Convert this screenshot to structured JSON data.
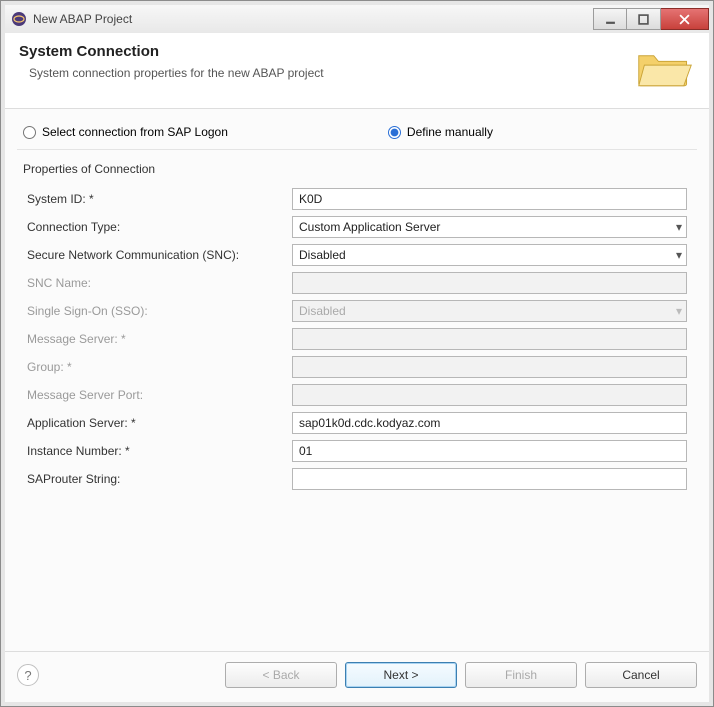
{
  "window": {
    "title": "New ABAP Project"
  },
  "header": {
    "title": "System Connection",
    "subtitle": "System connection properties for the new ABAP project"
  },
  "radios": {
    "sapLogon": "Select connection from SAP Logon",
    "manual": "Define manually"
  },
  "group": {
    "legend": "Properties of Connection"
  },
  "labels": {
    "systemId": "System ID: *",
    "connType": "Connection Type:",
    "snc": "Secure Network Communication (SNC):",
    "sncName": "SNC Name:",
    "sso": "Single Sign-On (SSO):",
    "msgServer": "Message Server: *",
    "group": "Group: *",
    "msgPort": "Message Server Port:",
    "appServer": "Application Server: *",
    "instance": "Instance Number: *",
    "saprouter": "SAProuter String:"
  },
  "values": {
    "systemId": "K0D",
    "connType": "Custom Application Server",
    "snc": "Disabled",
    "sncName": "",
    "sso": "Disabled",
    "msgServer": "",
    "group": "",
    "msgPort": "",
    "appServer": "sap01k0d.cdc.kodyaz.com",
    "instance": "01",
    "saprouter": ""
  },
  "buttons": {
    "back": "< Back",
    "next": "Next >",
    "finish": "Finish",
    "cancel": "Cancel"
  }
}
